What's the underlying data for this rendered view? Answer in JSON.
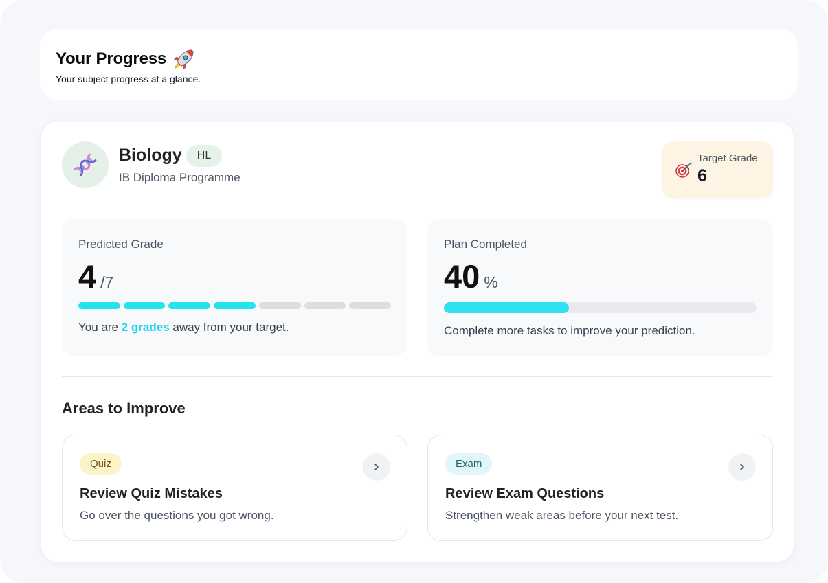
{
  "header": {
    "title": "Your Progress",
    "title_icon": "rocket-icon",
    "subtitle": "Your subject progress at a glance."
  },
  "subject": {
    "icon": "dna-icon",
    "name": "Biology",
    "level": "HL",
    "programme": "IB Diploma Programme"
  },
  "target": {
    "icon": "dart-target-icon",
    "label": "Target Grade",
    "value": "6"
  },
  "predicted": {
    "label": "Predicted Grade",
    "value": "4",
    "suffix": "/7",
    "filled_segments": 4,
    "total_segments": 7,
    "message_before": "You are ",
    "message_highlight": "2 grades",
    "message_after": " away from your target."
  },
  "plan": {
    "label": "Plan Completed",
    "value": "40",
    "suffix": "%",
    "progress_fraction": 0.4,
    "message": "Complete more tasks to improve your prediction."
  },
  "areas": {
    "title": "Areas to Improve",
    "items": [
      {
        "tag": "Quiz",
        "title": "Review Quiz Mistakes",
        "description": "Go over the questions you got wrong.",
        "action_icon": "chevron-right-icon"
      },
      {
        "tag": "Exam",
        "title": "Review Exam Questions",
        "description": "Strengthen weak areas before your next test.",
        "action_icon": "chevron-right-icon"
      }
    ]
  },
  "colors": {
    "accent": "#22e3ee",
    "segment_empty": "#dedede",
    "quiz_tag_bg": "#fdf3c8",
    "exam_tag_bg": "#e0f7fa",
    "target_card_bg": "#fdf4e3",
    "subject_avatar_bg": "#e5f1e8"
  }
}
